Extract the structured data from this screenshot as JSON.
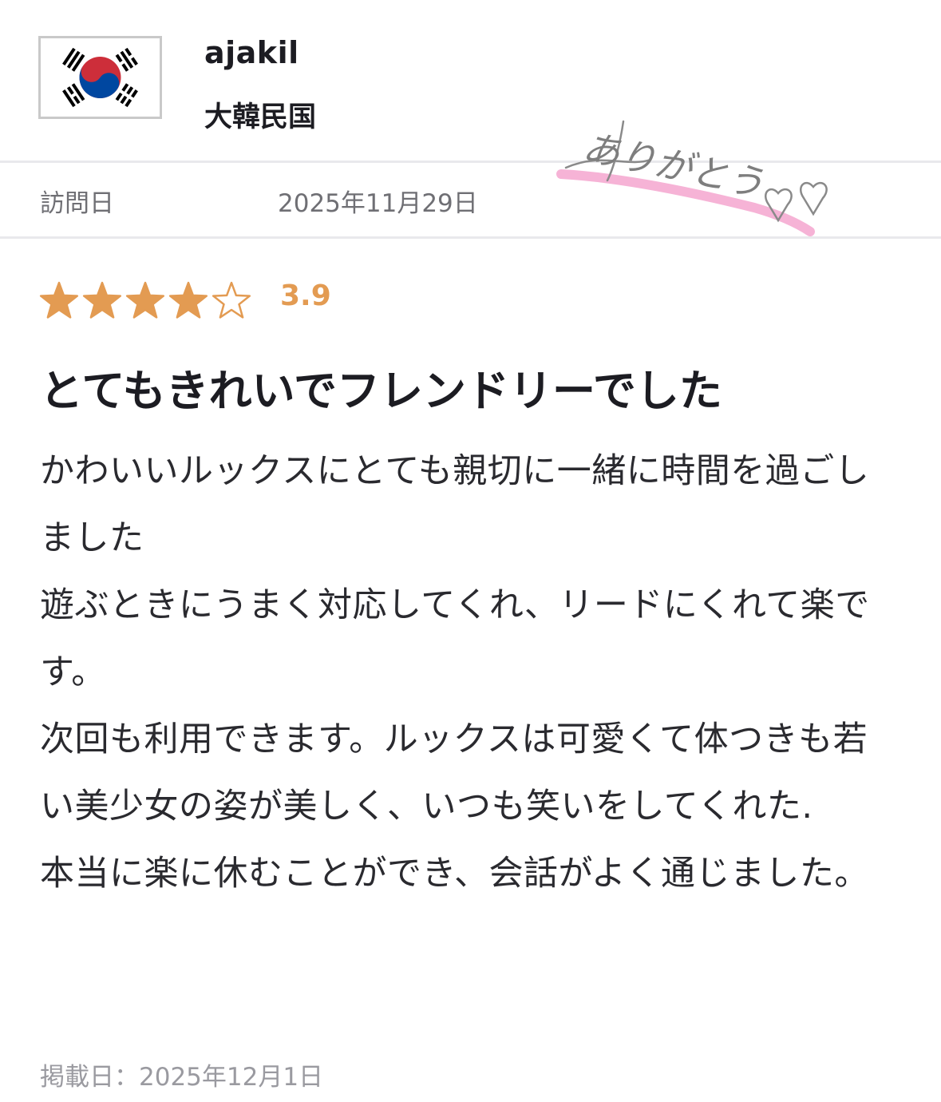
{
  "reviewer": {
    "name": "ajakil",
    "country": "大韓民国",
    "flag_icon": "south-korea-flag-icon"
  },
  "visit": {
    "label": "訪問日",
    "date": "2025年11月29日"
  },
  "rating": {
    "score_text": "3.9",
    "score": 3.9,
    "max": 5,
    "star_color": "#e39b52"
  },
  "review": {
    "title": "とてもきれいでフレンドリーでした",
    "paragraphs": [
      "かわいいルックスにとても親切に一緒に時間を過ごしました",
      "遊ぶときにうまく対応してくれ、リードにくれて楽です。",
      "次回も利用できます。ルックスは可愛くて体つきも若い美少女の姿が美しく、いつも笑いをしてくれた.",
      "本当に楽に休むことができ、会話がよく通じました。"
    ]
  },
  "posted": "掲載日：2025年12月1日",
  "stamp": {
    "text": "ありがとう",
    "underline_color": "#f4a6cf"
  }
}
